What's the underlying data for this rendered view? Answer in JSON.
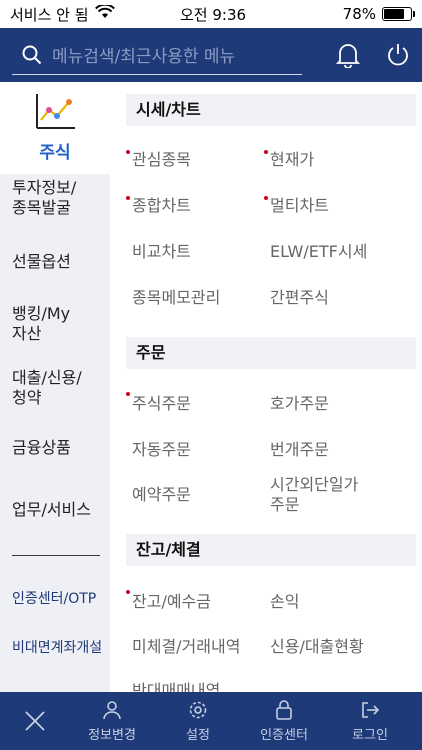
{
  "status_bar": {
    "carrier": "서비스 안 됨",
    "time": "오전 9:36",
    "battery_percent": "78%",
    "battery_level": 0.78
  },
  "header": {
    "search_placeholder": "메뉴검색/최근사용한 메뉴"
  },
  "sidebar": {
    "active": "주식",
    "items": [
      "투자정보/\n종목발굴",
      "선물옵션",
      "뱅킹/My\n자산",
      "대출/신용/\n청약",
      "금융상품",
      "업무/서비스"
    ],
    "links": [
      "인증센터/OTP",
      "비대면계좌개설"
    ]
  },
  "sections": [
    {
      "title": "시세/차트",
      "items": [
        {
          "label": "관심종목",
          "dot": true
        },
        {
          "label": "현재가",
          "dot": true
        },
        {
          "label": "종합차트",
          "dot": true
        },
        {
          "label": "멀티차트",
          "dot": true
        },
        {
          "label": "비교차트",
          "dot": false
        },
        {
          "label": "ELW/ETF시세",
          "dot": false
        },
        {
          "label": "종목메모관리",
          "dot": false
        },
        {
          "label": "간편주식",
          "dot": false
        }
      ]
    },
    {
      "title": "주문",
      "items": [
        {
          "label": "주식주문",
          "dot": true
        },
        {
          "label": "호가주문",
          "dot": false
        },
        {
          "label": "자동주문",
          "dot": false
        },
        {
          "label": "번개주문",
          "dot": false
        },
        {
          "label": "예약주문",
          "dot": false
        },
        {
          "label": "시간외단일가\n주문",
          "dot": false
        }
      ]
    },
    {
      "title": "잔고/체결",
      "items": [
        {
          "label": "잔고/예수금",
          "dot": true
        },
        {
          "label": "손익",
          "dot": false
        },
        {
          "label": "미체결/거래내역",
          "dot": false
        },
        {
          "label": "신용/대출현황",
          "dot": false
        },
        {
          "label": "반대매매내역",
          "dot": false
        }
      ]
    }
  ],
  "tabbar": {
    "tabs": [
      "정보변경",
      "설정",
      "인증센터",
      "로그인"
    ]
  }
}
